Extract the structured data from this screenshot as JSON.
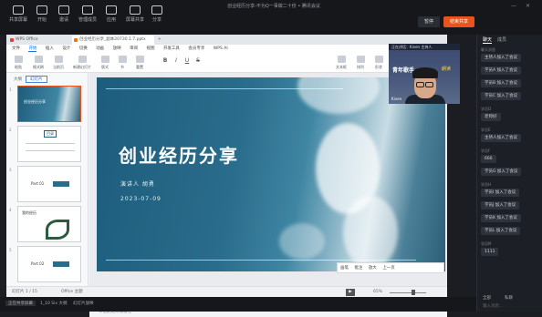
{
  "meeting": {
    "title": "创业经历分享-不为Q一事做二十份 • 腾讯会议",
    "toolbar": [
      {
        "label": "共享屏幕",
        "icon": "screen-icon"
      },
      {
        "label": "开始",
        "icon": "play-icon"
      },
      {
        "label": "邀请",
        "icon": "invite-icon"
      },
      {
        "label": "管理成员",
        "icon": "members-icon"
      },
      {
        "label": "应用",
        "icon": "apps-icon"
      },
      {
        "label": "屏幕共享",
        "icon": "share-icon"
      },
      {
        "label": "分享",
        "icon": "forward-icon"
      }
    ],
    "pause_label": "暂停",
    "end_share_label": "结束共享"
  },
  "wps": {
    "tabs": [
      "WPS Office",
      "创业经历分享_副本20730.1.7.pptx",
      "+"
    ],
    "menu": [
      "文件",
      "开始",
      "插入",
      "设计",
      "切换",
      "动画",
      "放映",
      "审阅",
      "视图",
      "开发工具",
      "会员专享",
      "WPS AI"
    ],
    "menu_selected": "开始",
    "ribbon": [
      "粘贴",
      "格式刷",
      "当前页",
      "新建幻灯片",
      "版式",
      "节",
      "重置",
      "B",
      "I",
      "U",
      "S",
      "文本框",
      "排列",
      "形状",
      "查找"
    ],
    "panel_tabs": [
      "大纲",
      "幻灯片"
    ],
    "panel_tab_selected": "幻灯片",
    "thumbs": [
      {
        "num": "1",
        "title": "创业经历分享"
      },
      {
        "num": "2",
        "title": "目录"
      },
      {
        "num": "3",
        "title": "Part 01"
      },
      {
        "num": "4",
        "title": "我的经历"
      },
      {
        "num": "5",
        "title": "Part 02"
      }
    ],
    "slide": {
      "title": "创业经历分享",
      "speaker": "演讲人 胡勇",
      "date": "2023-07-09"
    },
    "notes_placeholder": "单击此处添加备注",
    "present_tools": [
      "画笔",
      "批注",
      "放大",
      "上一页"
    ],
    "status": {
      "slide_label": "幻灯片 1 / 15",
      "theme": "Office 主题",
      "zoom": "65%"
    }
  },
  "camera": {
    "name": "Kiven",
    "top_text": "正在讲话：Kiven 主持人",
    "brand": "青年歌手",
    "brand_right": "朗读"
  },
  "chat": {
    "tabs": [
      "聊天",
      "成员"
    ],
    "active_tab": "聊天",
    "messages": [
      {
        "type": "lbl",
        "text": "聊天消息"
      },
      {
        "type": "bub",
        "text": "主持人加入了会议"
      },
      {
        "type": "bub",
        "text": "学员A 加入了会议"
      },
      {
        "type": "bub",
        "text": "学员B 加入了会议"
      },
      {
        "type": "bub",
        "text": "学员C 加入了会议"
      },
      {
        "type": "lbl",
        "text": "学员D"
      },
      {
        "type": "bub",
        "text": "老师好"
      },
      {
        "type": "lbl",
        "text": "学员E"
      },
      {
        "type": "bub",
        "text": "主持人加入了会议"
      },
      {
        "type": "lbl",
        "text": "学员F"
      },
      {
        "type": "bub",
        "text": "666"
      },
      {
        "type": "bub",
        "text": "学员G 加入了会议"
      },
      {
        "type": "lbl",
        "text": "学员H"
      },
      {
        "type": "bub",
        "text": "学员I 加入了会议"
      },
      {
        "type": "bub",
        "text": "学员J 加入了会议"
      },
      {
        "type": "bub",
        "text": "学员K 加入了会议"
      },
      {
        "type": "bub",
        "text": "学员L 加入了会议"
      },
      {
        "type": "lbl",
        "text": "学员M"
      },
      {
        "type": "bub",
        "text": "1111"
      }
    ],
    "bottom": [
      "全部",
      "私聊"
    ],
    "input_placeholder": "输入消息..."
  },
  "taskbar": [
    {
      "label": "正在共享屏幕"
    },
    {
      "label": "1_10 Six 大纲"
    },
    {
      "label": "幻灯片放映"
    }
  ]
}
